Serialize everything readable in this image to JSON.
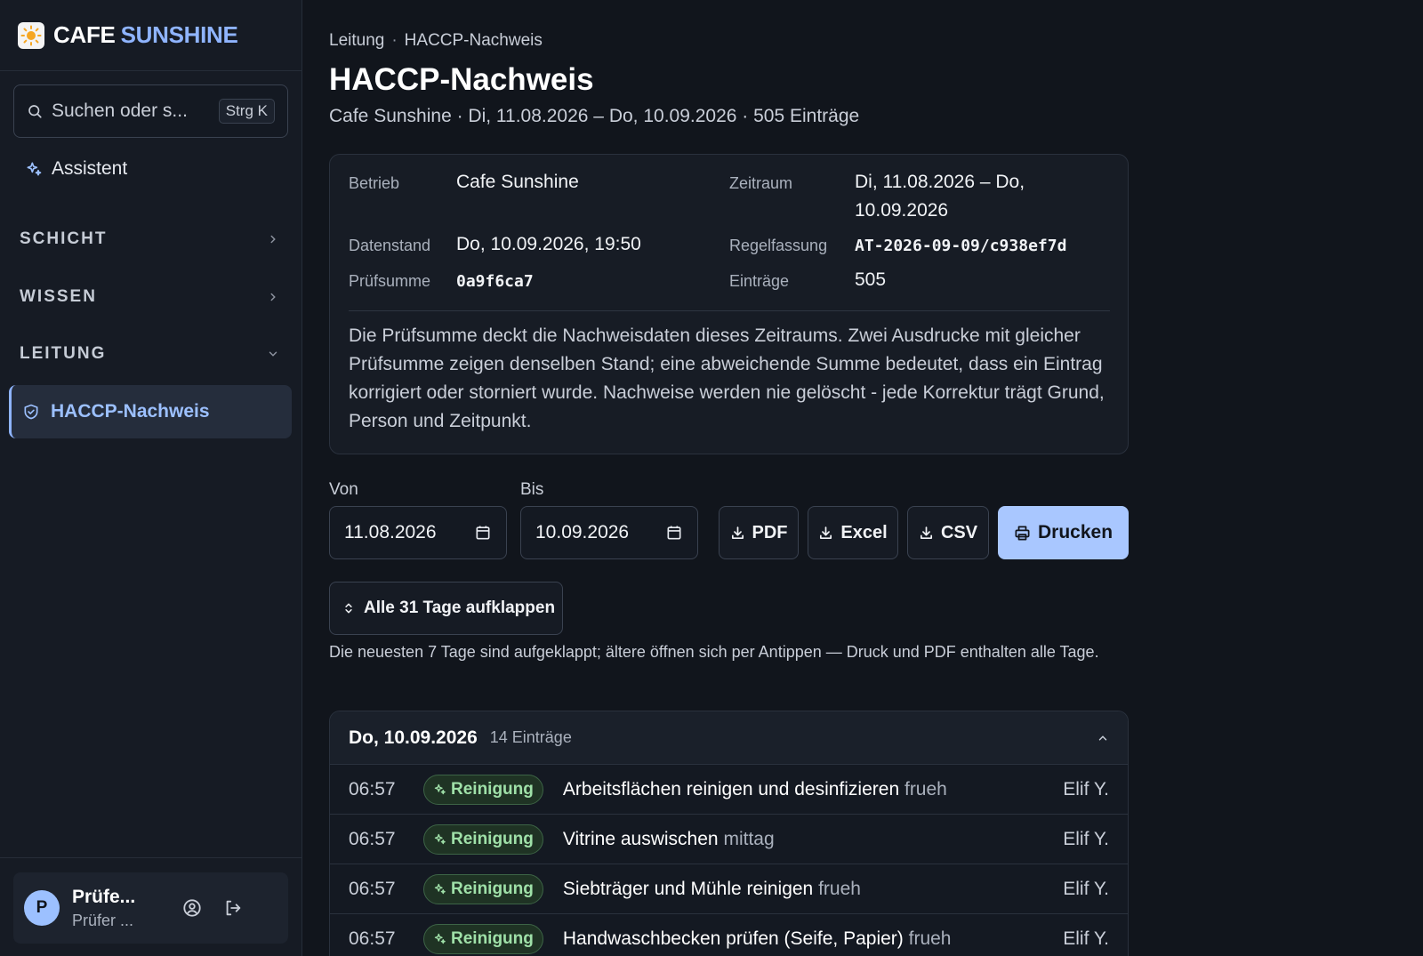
{
  "brand": {
    "part1": "CAFE",
    "part2": "SUNSHINE",
    "logo_icon": "sun-icon"
  },
  "sidebar": {
    "search_placeholder": "Suchen oder s...",
    "search_shortcut": "Strg K",
    "assistant_label": "Assistent",
    "sections": [
      {
        "label": "SCHICHT",
        "state": "collapsed"
      },
      {
        "label": "WISSEN",
        "state": "collapsed"
      },
      {
        "label": "LEITUNG",
        "state": "expanded"
      }
    ],
    "active_item": {
      "label": "HACCP-Nachweis",
      "icon": "shield-check-icon"
    },
    "user": {
      "initial": "P",
      "name": "Prüfe...",
      "role": "Prüfer ..."
    }
  },
  "breadcrumb": {
    "parent": "Leitung",
    "separator": "·",
    "current": "HACCP-Nachweis"
  },
  "page": {
    "title": "HACCP-Nachweis",
    "subtitle": "Cafe Sunshine · Di, 11.08.2026 – Do, 10.09.2026 · 505 Einträge"
  },
  "meta": {
    "betrieb_label": "Betrieb",
    "betrieb_value": "Cafe Sunshine",
    "zeitraum_label": "Zeitraum",
    "zeitraum_line1": "Di, 11.08.2026 – Do,",
    "zeitraum_line2": "10.09.2026",
    "datenstand_label": "Datenstand",
    "datenstand_value": "Do, 10.09.2026, 19:50",
    "regelfassung_label": "Regelfassung",
    "regelfassung_value": "AT-2026-09-09/c938ef7d",
    "pruefsumme_label": "Prüfsumme",
    "pruefsumme_value": "0a9f6ca7",
    "eintraege_label": "Einträge",
    "eintraege_value": "505",
    "note": "Die Prüfsumme deckt die Nachweisdaten dieses Zeitraums. Zwei Ausdrucke mit gleicher Prüfsumme zeigen denselben Stand; eine abweichende Summe bedeutet, dass ein Eintrag korrigiert oder storniert wurde. Nachweise werden nie gelöscht - jede Korrektur trägt Grund, Person und Zeitpunkt."
  },
  "filters": {
    "von_label": "Von",
    "von_value": "11.08.2026",
    "bis_label": "Bis",
    "bis_value": "10.09.2026"
  },
  "actions": {
    "pdf": "PDF",
    "excel": "Excel",
    "csv": "CSV",
    "print": "Drucken"
  },
  "expand": {
    "label": "Alle 31 Tage aufklappen",
    "hint": "Die neuesten 7 Tage sind aufgeklappt; ältere öffnen sich per Antippen — Druck und PDF enthalten alle Tage."
  },
  "day": {
    "date": "Do, 10.09.2026",
    "count": "14 Einträge",
    "entries": [
      {
        "time": "06:57",
        "category": "Reinigung",
        "task": "Arbeitsflächen reinigen und desinfizieren",
        "shift": "frueh",
        "person": "Elif Y."
      },
      {
        "time": "06:57",
        "category": "Reinigung",
        "task": "Vitrine auswischen",
        "shift": "mittag",
        "person": "Elif Y."
      },
      {
        "time": "06:57",
        "category": "Reinigung",
        "task": "Siebträger und Mühle reinigen",
        "shift": "frueh",
        "person": "Elif Y."
      },
      {
        "time": "06:57",
        "category": "Reinigung",
        "task": "Handwaschbecken prüfen (Seife, Papier)",
        "shift": "frueh",
        "person": "Elif Y."
      }
    ]
  },
  "colors": {
    "accent": "#8fb4ff",
    "primary_button": "#a9c7ff",
    "badge_green": "#9fe0a8",
    "background": "#11151c"
  }
}
